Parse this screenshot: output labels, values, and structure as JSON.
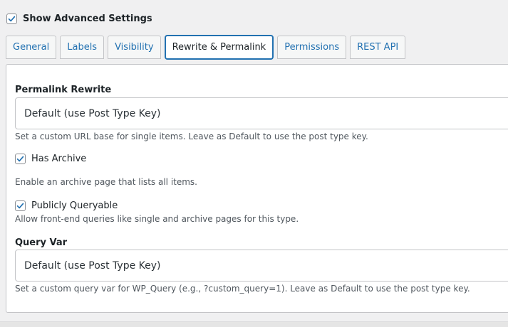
{
  "advanced": {
    "label": "Show Advanced Settings",
    "checked": true
  },
  "tabs": [
    {
      "label": "General"
    },
    {
      "label": "Labels"
    },
    {
      "label": "Visibility"
    },
    {
      "label": "Rewrite & Permalink"
    },
    {
      "label": "Permissions"
    },
    {
      "label": "REST API"
    }
  ],
  "active_tab": "Rewrite & Permalink",
  "permalink": {
    "label": "Permalink Rewrite",
    "value": "Default (use Post Type Key)",
    "description": "Set a custom URL base for single items. Leave as Default to use the post type key."
  },
  "has_archive": {
    "label": "Has Archive",
    "checked": true,
    "description": "Enable an archive page that lists all items."
  },
  "publicly_queryable": {
    "label": "Publicly Queryable",
    "checked": true,
    "description": "Allow front-end queries like single and archive pages for this type."
  },
  "query_var": {
    "label": "Query Var",
    "value": "Default (use Post Type Key)",
    "description": "Set a custom query var for WP_Query (e.g., ?custom_query=1). Leave as Default to use the post type key."
  },
  "colors": {
    "accent": "#2271b1",
    "border": "#c3c4c7",
    "text": "#1d2327"
  }
}
